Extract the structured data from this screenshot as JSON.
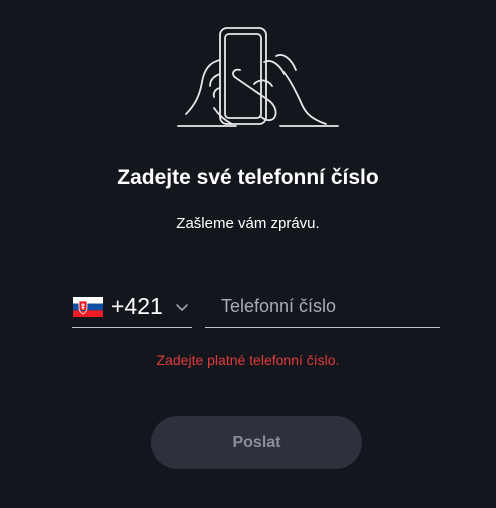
{
  "prompt": {
    "title": "Zadejte své telefonní číslo",
    "subtitle": "Zašleme vám zprávu."
  },
  "country_selector": {
    "flag": "slovakia-flag-icon",
    "dial_code": "+421",
    "dropdown_icon": "chevron-down-icon"
  },
  "phone_input": {
    "value": "",
    "placeholder": "Telefonní číslo"
  },
  "validation": {
    "error": "Zadejte platné telefonní číslo."
  },
  "actions": {
    "send_label": "Poslat",
    "send_disabled": true
  },
  "colors": {
    "background": "#14161d",
    "error": "#e23b3b",
    "button_bg": "#2e313b",
    "button_text": "#8a8e98"
  }
}
